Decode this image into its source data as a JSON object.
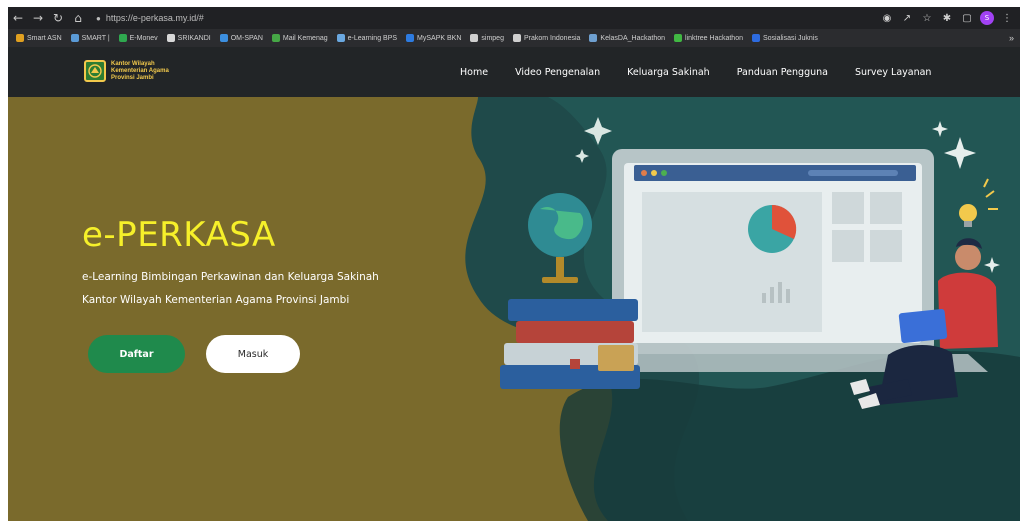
{
  "browser": {
    "url": "https://e-perkasa.my.id/#",
    "nav_icons": [
      "back-arrow-icon",
      "forward-arrow-icon",
      "reload-icon",
      "home-icon"
    ],
    "right_icons": [
      "extension-icon",
      "share-icon",
      "star-icon",
      "puzzle-icon",
      "sidebar-icon",
      "profile-avatar",
      "menu-dots-icon"
    ],
    "profile_initial": "S"
  },
  "bookmarks": [
    {
      "label": "Smart ASN",
      "color": "#e0a020"
    },
    {
      "label": "SMART |",
      "color": "#5a9ad6"
    },
    {
      "label": "E-Monev",
      "color": "#2fa84f"
    },
    {
      "label": "SRIKANDI",
      "color": "#d8d8d8"
    },
    {
      "label": "OM-SPAN",
      "color": "#3c8fe0"
    },
    {
      "label": "Mail Kemenag",
      "color": "#46a846"
    },
    {
      "label": "e-Learning BPS",
      "color": "#6aa8e0"
    },
    {
      "label": "MySAPK BKN",
      "color": "#2d7be0"
    },
    {
      "label": "simpeg",
      "color": "#cfcfcf"
    },
    {
      "label": "Prakom Indonesia",
      "color": "#d0d0d0"
    },
    {
      "label": "KelasDA_Hackathon",
      "color": "#6fa0d0"
    },
    {
      "label": "linktree Hackathon",
      "color": "#41b843"
    },
    {
      "label": "Sosialisasi Juknis",
      "color": "#2d6be0"
    }
  ],
  "bookmarks_more": "»",
  "site": {
    "logo_lines": [
      "Kantor Wilayah",
      "Kementerian Agama",
      "Provinsi Jambi"
    ],
    "menu": [
      "Home",
      "Video Pengenalan",
      "Keluarga Sakinah",
      "Panduan Pengguna",
      "Survey Layanan"
    ]
  },
  "hero": {
    "title": "e-PERKASA",
    "subtitle_line1": "e-Learning Bimbingan Perkawinan dan Keluarga Sakinah",
    "subtitle_line2": "Kantor Wilayah Kementerian Agama Provinsi Jambi",
    "btn_primary": "Daftar",
    "btn_secondary": "Masuk"
  },
  "colors": {
    "hero_bg": "#7a6a2c",
    "title": "#f6f02a",
    "primary_button": "#1f8a4c",
    "teal_shape": "#1f4a4a",
    "navbar": "#222527"
  }
}
